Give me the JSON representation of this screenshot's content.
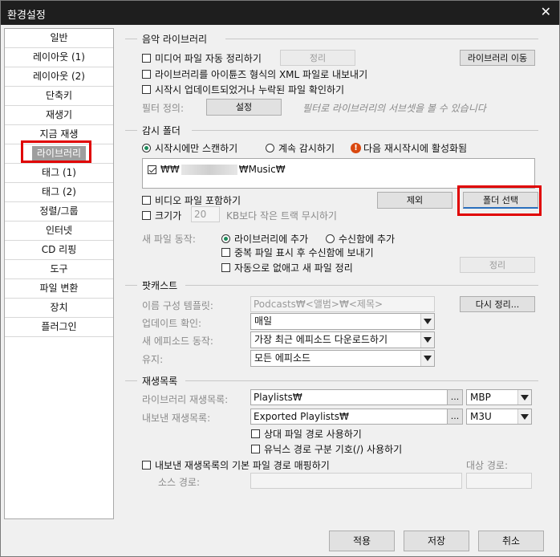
{
  "window": {
    "title": "환경설정",
    "close_glyph": "✕"
  },
  "sidebar": {
    "items": [
      "일반",
      "레이아웃 (1)",
      "레이아웃 (2)",
      "단축키",
      "재생기",
      "지금 재생",
      "라이브러리",
      "태그 (1)",
      "태그 (2)",
      "정렬/그룹",
      "인터넷",
      "CD 리핑",
      "도구",
      "파일 변환",
      "장치",
      "플러그인"
    ],
    "active": "라이브러리"
  },
  "music_library": {
    "title": "음악 라이브러리",
    "auto_organize": "미디어 파일 자동 정리하기",
    "organize_btn": "정리",
    "move_library_btn": "라이브러리 이동",
    "export_xml": "라이브러리를 아이튠즈 형식의 XML 파일로 내보내기",
    "check_on_start": "시작시 업데이트되었거나 누락된 파일 확인하기",
    "filter_label": "필터 정의:",
    "filter_btn": "설정",
    "filter_hint": "필터로 라이브러리의 서브셋을 볼 수 있습니다"
  },
  "watch_folder": {
    "title": "감시 폴더",
    "scan_on_start": "시작시에만 스캔하기",
    "continuous": "계속 감시하기",
    "warning_icon_glyph": "!",
    "activate_next": "다음 재시작시에 활성화됨",
    "folder_prefix": "₩₩",
    "folder_suffix": "₩Music₩",
    "include_video": "비디오 파일 포함하기",
    "remove_btn": "제외",
    "select_folder_btn": "폴더 선택",
    "size_prefix": "크기가",
    "size_value": "20",
    "size_suffix": "KB보다 작은 트랙 무시하기",
    "new_file_label": "새 파일 동작:",
    "add_library": "라이브러리에 추가",
    "add_inbox": "수신함에 추가",
    "dup_inbox": "중복 파일 표시 후 수신함에 보내기",
    "auto_organize": "자동으로 없애고 새 파일 정리",
    "organize_btn": "정리"
  },
  "podcast": {
    "title": "팟캐스트",
    "naming_label": "이름 구성 템플릿:",
    "naming_value": "Podcasts₩<앨범>₩<제목>",
    "reorganize_btn": "다시 정리...",
    "update_label": "업데이트 확인:",
    "update_value": "매일",
    "new_episode_label": "새 에피소드 동작:",
    "new_episode_value": "가장 최근 에피소드 다운로드하기",
    "keep_label": "유지:",
    "keep_value": "모든 에피소드"
  },
  "playlists": {
    "title": "재생목록",
    "lib_label": "라이브러리 재생목록:",
    "lib_value": "Playlists₩",
    "lib_format": "MBP",
    "export_label": "내보낸 재생목록:",
    "export_value": "Exported Playlists₩",
    "export_format": "M3U",
    "browse": "...",
    "relative": "상대 파일 경로 사용하기",
    "unix_sep": "유닉스 경로 구분 기호(/) 사용하기",
    "map_paths": "내보낸 재생목록의 기본 파일 경로 매핑하기",
    "target_label": "대상 경로:",
    "source_label": "소스 경로:"
  },
  "footer": {
    "apply": "적용",
    "save": "저장",
    "cancel": "취소"
  }
}
